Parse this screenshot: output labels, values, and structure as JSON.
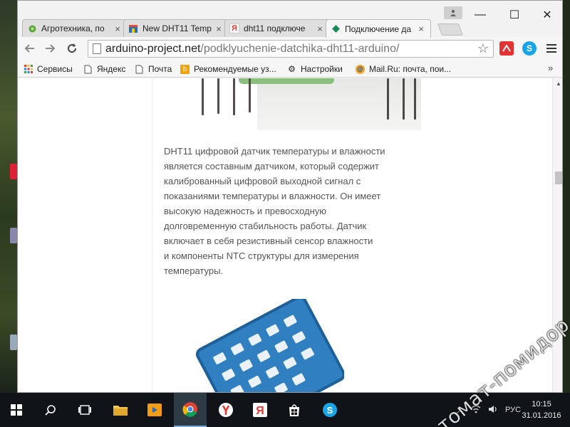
{
  "browser": {
    "tabs": [
      {
        "title": "Агротехника, по",
        "favicon": "leaf-favicon",
        "color": "#5aa83c"
      },
      {
        "title": "New DHT11 Temp",
        "favicon": "store-favicon",
        "color": "#c0392b"
      },
      {
        "title": "dht11 подключе",
        "favicon": "yandex-favicon",
        "glyph": "Я",
        "color": "#e53935"
      },
      {
        "title": "Подключение да",
        "favicon": "arduino-favicon",
        "color": "#1e8a5a"
      }
    ],
    "active_tab": 3,
    "tab_close_glyph": "×",
    "window_controls": {
      "minimize": "—",
      "maximize": "☐",
      "close": "✕"
    },
    "url": {
      "host": "arduino-project.net",
      "path": "/podklyuchenie-datchika-dht11-arduino/"
    },
    "bookmarks": [
      {
        "label": "Сервисы",
        "icon": "apps-icon"
      },
      {
        "label": "Яндекс",
        "icon": "page-icon"
      },
      {
        "label": "Почта",
        "icon": "page-icon"
      },
      {
        "label": "Рекомендуемые уз...",
        "icon": "bing-icon"
      },
      {
        "label": "Настройки",
        "icon": "gear-icon"
      },
      {
        "label": "Mail.Ru: почта, пои...",
        "icon": "mailru-icon"
      }
    ],
    "bookmarks_overflow": "»"
  },
  "article": {
    "lines": [
      "DHT11 цифровой датчик температуры и влажности",
      "является составным датчиком, который содержит",
      "калиброванный цифровой выходной сигнал с",
      "показаниями температуры и влажности. Он имеет",
      "высокую надежность и превосходную",
      "долговременную стабильность работы. Датчик",
      "включает в себя резистивный сенсор влажности",
      "и компоненты NTC структуры для измерения",
      "температуры."
    ]
  },
  "taskbar": {
    "language": "РУС",
    "time": "10:15",
    "date": "31.01.2016",
    "apps": [
      "start-icon",
      "search-icon",
      "task-view-icon",
      "file-explorer-icon",
      "media-icon",
      "chrome-icon",
      "yandex-browser-icon",
      "yandex-icon",
      "store-icon",
      "skype-icon"
    ]
  },
  "watermark": "томат-помидор.com",
  "colors": {
    "taskbar": "#101418",
    "active_tab": "#f6f6f6",
    "sensor_blue": "#2f7fc1"
  }
}
